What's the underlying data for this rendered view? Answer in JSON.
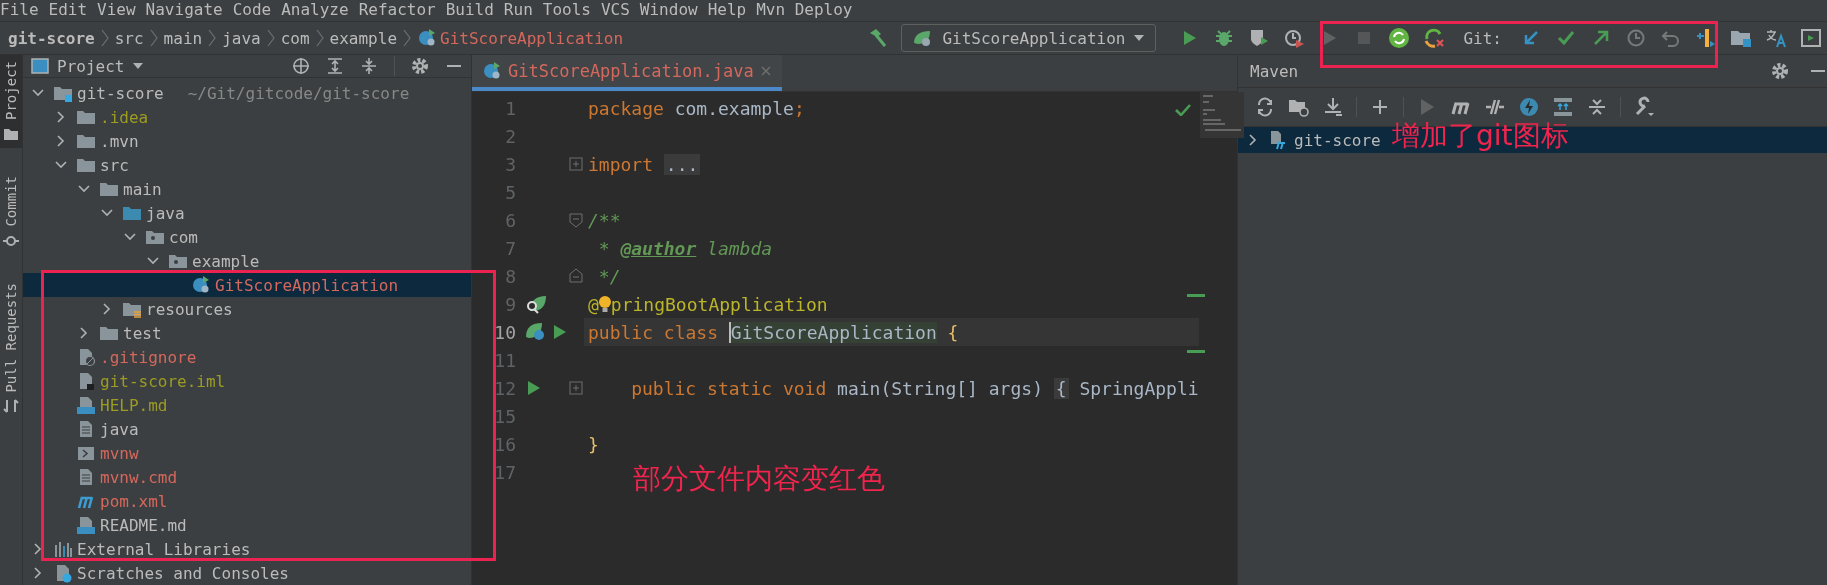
{
  "menu": [
    "File",
    "Edit",
    "View",
    "Navigate",
    "Code",
    "Analyze",
    "Refactor",
    "Build",
    "Run",
    "Tools",
    "VCS",
    "Window",
    "Help",
    "Mvn Deploy"
  ],
  "breadcrumb": [
    {
      "label": "git-score",
      "kind": "project"
    },
    {
      "label": "src",
      "kind": "dir"
    },
    {
      "label": "main",
      "kind": "dir"
    },
    {
      "label": "java",
      "kind": "dir"
    },
    {
      "label": "com",
      "kind": "dir"
    },
    {
      "label": "example",
      "kind": "dir"
    },
    {
      "label": "GitScoreApplication",
      "kind": "class"
    }
  ],
  "toolbar": [
    {
      "kind": "hammer",
      "disabled": false
    },
    {
      "kind": "config",
      "label": "GitScoreApplication"
    },
    {
      "kind": "run",
      "disabled": false
    },
    {
      "kind": "debug",
      "disabled": false
    },
    {
      "kind": "coverage",
      "disabled": false
    },
    {
      "kind": "profiler",
      "disabled": false
    },
    {
      "kind": "run",
      "disabled": true
    },
    {
      "kind": "stop",
      "disabled": true
    },
    {
      "kind": "sync",
      "disabled": false
    },
    {
      "kind": "sync-x",
      "disabled": false
    },
    {
      "kind": "label",
      "label": "Git:"
    },
    {
      "kind": "update",
      "disabled": false
    },
    {
      "kind": "commit",
      "disabled": false
    },
    {
      "kind": "push",
      "disabled": false
    },
    {
      "kind": "history",
      "disabled": true
    },
    {
      "kind": "rollback",
      "disabled": true
    },
    {
      "kind": "annotate",
      "disabled": false
    },
    {
      "kind": "folder",
      "disabled": false
    },
    {
      "kind": "translate",
      "disabled": false
    },
    {
      "kind": "window",
      "disabled": false
    }
  ],
  "side_tabs": [
    {
      "label": "Project",
      "kind": "folder",
      "selected": true
    },
    {
      "label": "Commit",
      "kind": "commit",
      "selected": false
    },
    {
      "label": "Pull Requests",
      "kind": "pull",
      "selected": false
    }
  ],
  "project": {
    "title": "Project",
    "tree": [
      {
        "label": "git-score",
        "path": "~/Git/gitcode/git-score",
        "kind": "project",
        "expanded": true,
        "selected": false,
        "color": "#bbbbbb",
        "children": [
          {
            "label": ".idea",
            "kind": "folder",
            "expanded": false,
            "selected": false,
            "color": "#9c9c22"
          },
          {
            "label": ".mvn",
            "kind": "folder",
            "expanded": false,
            "selected": false,
            "color": "#bbbbbb"
          },
          {
            "label": "src",
            "kind": "folder",
            "expanded": true,
            "selected": false,
            "color": "#bbbbbb",
            "children": [
              {
                "label": "main",
                "kind": "folder",
                "expanded": true,
                "selected": false,
                "color": "#bbbbbb",
                "children": [
                  {
                    "label": "java",
                    "kind": "folder-src",
                    "expanded": true,
                    "selected": false,
                    "color": "#bbbbbb",
                    "children": [
                      {
                        "label": "com",
                        "kind": "package",
                        "expanded": true,
                        "selected": false,
                        "color": "#bbbbbb",
                        "children": [
                          {
                            "label": "example",
                            "kind": "package",
                            "expanded": true,
                            "selected": false,
                            "color": "#bbbbbb",
                            "children": [
                              {
                                "label": "GitScoreApplication",
                                "kind": "spring-class",
                                "selected": true,
                                "color": "#d5685d"
                              }
                            ]
                          }
                        ]
                      }
                    ]
                  },
                  {
                    "label": "resources",
                    "kind": "folder-res",
                    "expanded": false,
                    "selected": false,
                    "color": "#bbbbbb"
                  }
                ]
              },
              {
                "label": "test",
                "kind": "folder",
                "expanded": false,
                "selected": false,
                "color": "#bbbbbb"
              }
            ]
          },
          {
            "label": ".gitignore",
            "kind": "file-ignore",
            "selected": false,
            "color": "#d5685d"
          },
          {
            "label": "git-score.iml",
            "kind": "file-iml",
            "selected": false,
            "color": "#9c9c22"
          },
          {
            "label": "HELP.md",
            "kind": "file-md",
            "selected": false,
            "color": "#9c9c22"
          },
          {
            "label": "java",
            "kind": "file-text",
            "selected": false,
            "color": "#bbbbbb"
          },
          {
            "label": "mvnw",
            "kind": "file-exec",
            "selected": false,
            "color": "#d5685d"
          },
          {
            "label": "mvnw.cmd",
            "kind": "file-text",
            "selected": false,
            "color": "#d5685d"
          },
          {
            "label": "pom.xml",
            "kind": "maven",
            "selected": false,
            "color": "#d5685d"
          },
          {
            "label": "README.md",
            "kind": "file-md",
            "selected": false,
            "color": "#bbbbbb"
          }
        ]
      },
      {
        "label": "External Libraries",
        "kind": "libraries",
        "expanded": false,
        "selected": false,
        "color": "#bbbbbb"
      },
      {
        "label": "Scratches and Consoles",
        "kind": "scratches",
        "expanded": false,
        "selected": false,
        "color": "#bbbbbb"
      }
    ]
  },
  "editor": {
    "tab": {
      "label": "GitScoreApplication.java",
      "selected": true
    },
    "lines": [
      {
        "number": "1",
        "current": false,
        "tokens": [
          {
            "kind": "keyword",
            "text": "package"
          },
          {
            "kind": "plain-sp",
            "text": "com.example"
          },
          {
            "kind": "keyword",
            "text": ";"
          }
        ]
      },
      {
        "number": "2",
        "current": false
      },
      {
        "number": "3",
        "current": false,
        "fold": {
          "kind": "collapsed"
        },
        "tokens": [
          {
            "kind": "keyword",
            "text": "import"
          },
          {
            "kind": "folded-sp",
            "text": "..."
          }
        ]
      },
      {
        "number": "5",
        "current": false
      },
      {
        "number": "6",
        "current": false,
        "fold": {
          "kind": "open"
        },
        "tokens": [
          {
            "kind": "doc",
            "text": "/**"
          }
        ]
      },
      {
        "number": "7",
        "current": false,
        "tokens": [
          {
            "kind": "doc-lead",
            "text": "*"
          },
          {
            "kind": "doc-tag",
            "text": "@author"
          },
          {
            "kind": "doc-sp",
            "text": "lambda"
          }
        ]
      },
      {
        "number": "8",
        "current": false,
        "fold": {
          "kind": "close"
        },
        "tokens": [
          {
            "kind": "doc-lead",
            "text": "*/"
          }
        ]
      },
      {
        "number": "9",
        "current": false,
        "gutter": [
          {
            "kind": "spring-search"
          }
        ],
        "tokens": [
          {
            "kind": "annotation",
            "text": "@"
          },
          {
            "kind": "bulb"
          },
          {
            "kind": "annotation",
            "text": "pringBootApplication"
          }
        ]
      },
      {
        "number": "10",
        "current": true,
        "gutter": [
          {
            "kind": "spring-bean"
          },
          {
            "kind": "run"
          }
        ],
        "tokens": [
          {
            "kind": "keyword",
            "text": "public class"
          },
          {
            "kind": "highlight",
            "text": "GitScoreApplication"
          },
          {
            "kind": "brace-sp",
            "text": "{"
          }
        ]
      },
      {
        "number": "11",
        "current": false
      },
      {
        "number": "12",
        "current": false,
        "fold": {
          "kind": "collapsed"
        },
        "gutter": [
          {
            "kind": "run"
          }
        ],
        "tokens": [
          {
            "kind": "keyword-indent",
            "text": "public static void"
          },
          {
            "kind": "plain-sp",
            "text": "main(String[] args)"
          },
          {
            "kind": "folded-sp",
            "text": "{"
          },
          {
            "kind": "plain-sp",
            "text": "SpringAppli"
          }
        ]
      },
      {
        "number": "15",
        "current": false
      },
      {
        "number": "16",
        "current": false,
        "tokens": [
          {
            "kind": "brace",
            "text": "}"
          }
        ]
      },
      {
        "number": "17",
        "current": false
      }
    ]
  },
  "maven": {
    "title": "Maven",
    "tools": [
      {
        "kind": "reload",
        "disabled": false
      },
      {
        "kind": "folder-reload",
        "disabled": false
      },
      {
        "kind": "download",
        "disabled": false
      },
      {
        "kind": "sep"
      },
      {
        "kind": "plus",
        "disabled": false
      },
      {
        "kind": "sep"
      },
      {
        "kind": "run",
        "disabled": true
      },
      {
        "kind": "maven",
        "disabled": false
      },
      {
        "kind": "skip",
        "disabled": false
      },
      {
        "kind": "offline",
        "disabled": false
      },
      {
        "kind": "expand",
        "disabled": false
      },
      {
        "kind": "collapse",
        "disabled": false
      },
      {
        "kind": "sep"
      },
      {
        "kind": "wrench",
        "disabled": false
      }
    ],
    "tree": [
      {
        "label": "git-score",
        "expanded": false,
        "selected": true
      }
    ]
  },
  "annotations": [
    "增加了git图标",
    "部分文件内容变红色"
  ]
}
